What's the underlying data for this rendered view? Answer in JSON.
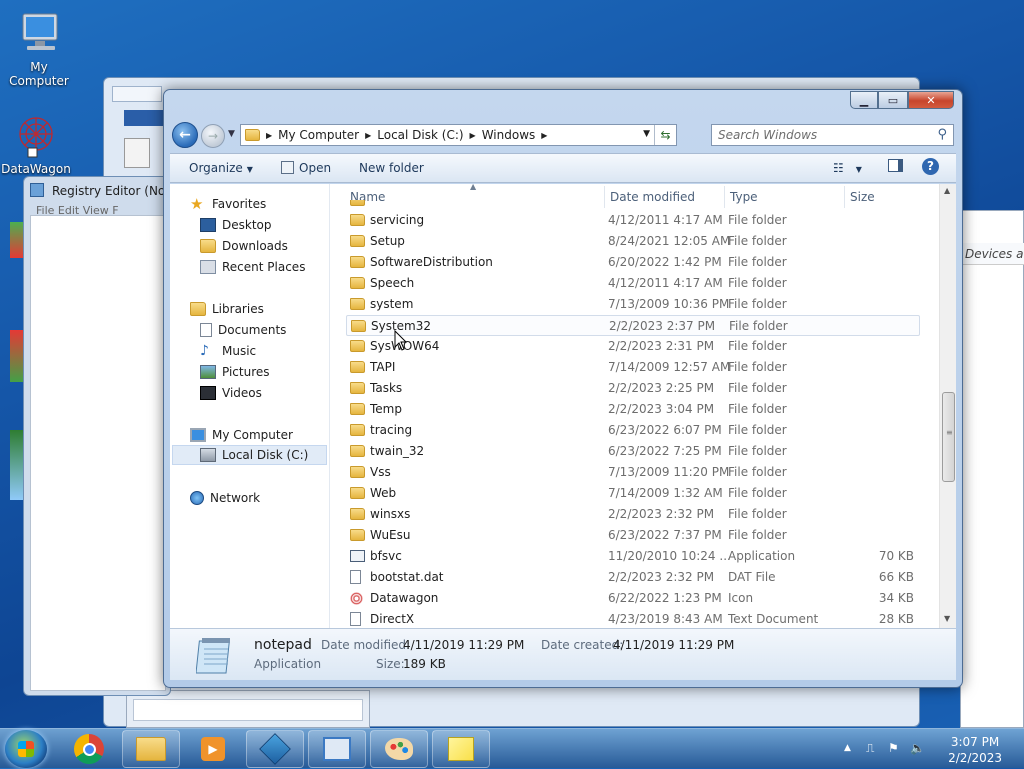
{
  "desktop": {
    "icons": [
      {
        "label": "My Computer"
      },
      {
        "label": "DataWagon"
      }
    ]
  },
  "background": {
    "registry_title": "Registry Editor (Not R",
    "registry_menu": "File  Edit  View  F",
    "devices_text": "Devices and"
  },
  "explorer": {
    "address": [
      "My Computer",
      "Local Disk (C:)",
      "Windows"
    ],
    "search_placeholder": "Search Windows",
    "toolbar": {
      "organize": "Organize",
      "open": "Open",
      "new_folder": "New folder"
    },
    "nav": {
      "favorites": "Favorites",
      "desktop": "Desktop",
      "downloads": "Downloads",
      "recent": "Recent Places",
      "libraries": "Libraries",
      "documents": "Documents",
      "music": "Music",
      "pictures": "Pictures",
      "videos": "Videos",
      "computer": "My Computer",
      "local_disk": "Local Disk (C:)",
      "network": "Network"
    },
    "columns": {
      "name": "Name",
      "date": "Date modified",
      "type": "Type",
      "size": "Size"
    },
    "rows": [
      {
        "name": "servicing",
        "date": "4/12/2011 4:17 AM",
        "type": "File folder",
        "size": ""
      },
      {
        "name": "Setup",
        "date": "8/24/2021 12:05 AM",
        "type": "File folder",
        "size": ""
      },
      {
        "name": "SoftwareDistribution",
        "date": "6/20/2022 1:42 PM",
        "type": "File folder",
        "size": ""
      },
      {
        "name": "Speech",
        "date": "4/12/2011 4:17 AM",
        "type": "File folder",
        "size": ""
      },
      {
        "name": "system",
        "date": "7/13/2009 10:36 PM",
        "type": "File folder",
        "size": ""
      },
      {
        "name": "System32",
        "date": "2/2/2023 2:37 PM",
        "type": "File folder",
        "size": ""
      },
      {
        "name": "SysWOW64",
        "date": "2/2/2023 2:31 PM",
        "type": "File folder",
        "size": ""
      },
      {
        "name": "TAPI",
        "date": "7/14/2009 12:57 AM",
        "type": "File folder",
        "size": ""
      },
      {
        "name": "Tasks",
        "date": "2/2/2023 2:25 PM",
        "type": "File folder",
        "size": ""
      },
      {
        "name": "Temp",
        "date": "2/2/2023 3:04 PM",
        "type": "File folder",
        "size": ""
      },
      {
        "name": "tracing",
        "date": "6/23/2022 6:07 PM",
        "type": "File folder",
        "size": ""
      },
      {
        "name": "twain_32",
        "date": "6/23/2022 7:25 PM",
        "type": "File folder",
        "size": ""
      },
      {
        "name": "Vss",
        "date": "7/13/2009 11:20 PM",
        "type": "File folder",
        "size": ""
      },
      {
        "name": "Web",
        "date": "7/14/2009 1:32 AM",
        "type": "File folder",
        "size": ""
      },
      {
        "name": "winsxs",
        "date": "2/2/2023 2:32 PM",
        "type": "File folder",
        "size": ""
      },
      {
        "name": "WuEsu",
        "date": "6/23/2022 7:37 PM",
        "type": "File folder",
        "size": ""
      },
      {
        "name": "bfsvc",
        "date": "11/20/2010 10:24 ...",
        "type": "Application",
        "size": "70 KB"
      },
      {
        "name": "bootstat.dat",
        "date": "2/2/2023 2:32 PM",
        "type": "DAT File",
        "size": "66 KB"
      },
      {
        "name": "Datawagon",
        "date": "6/22/2022 1:23 PM",
        "type": "Icon",
        "size": "34 KB"
      },
      {
        "name": "DirectX",
        "date": "4/23/2019 8:43 AM",
        "type": "Text Document",
        "size": "28 KB"
      }
    ],
    "details": {
      "name": "notepad",
      "kind": "Application",
      "modified_label": "Date modified:",
      "modified_value": "4/11/2019 11:29 PM",
      "created_label": "Date created:",
      "created_value": "4/11/2019 11:29 PM",
      "size_label": "Size:",
      "size_value": "189 KB"
    }
  },
  "taskbar": {
    "time": "3:07 PM",
    "date": "2/2/2023"
  },
  "colors": {
    "accent": "#2a6bb8",
    "folder": "#e5b53f",
    "selection": "#e1ebf7"
  }
}
